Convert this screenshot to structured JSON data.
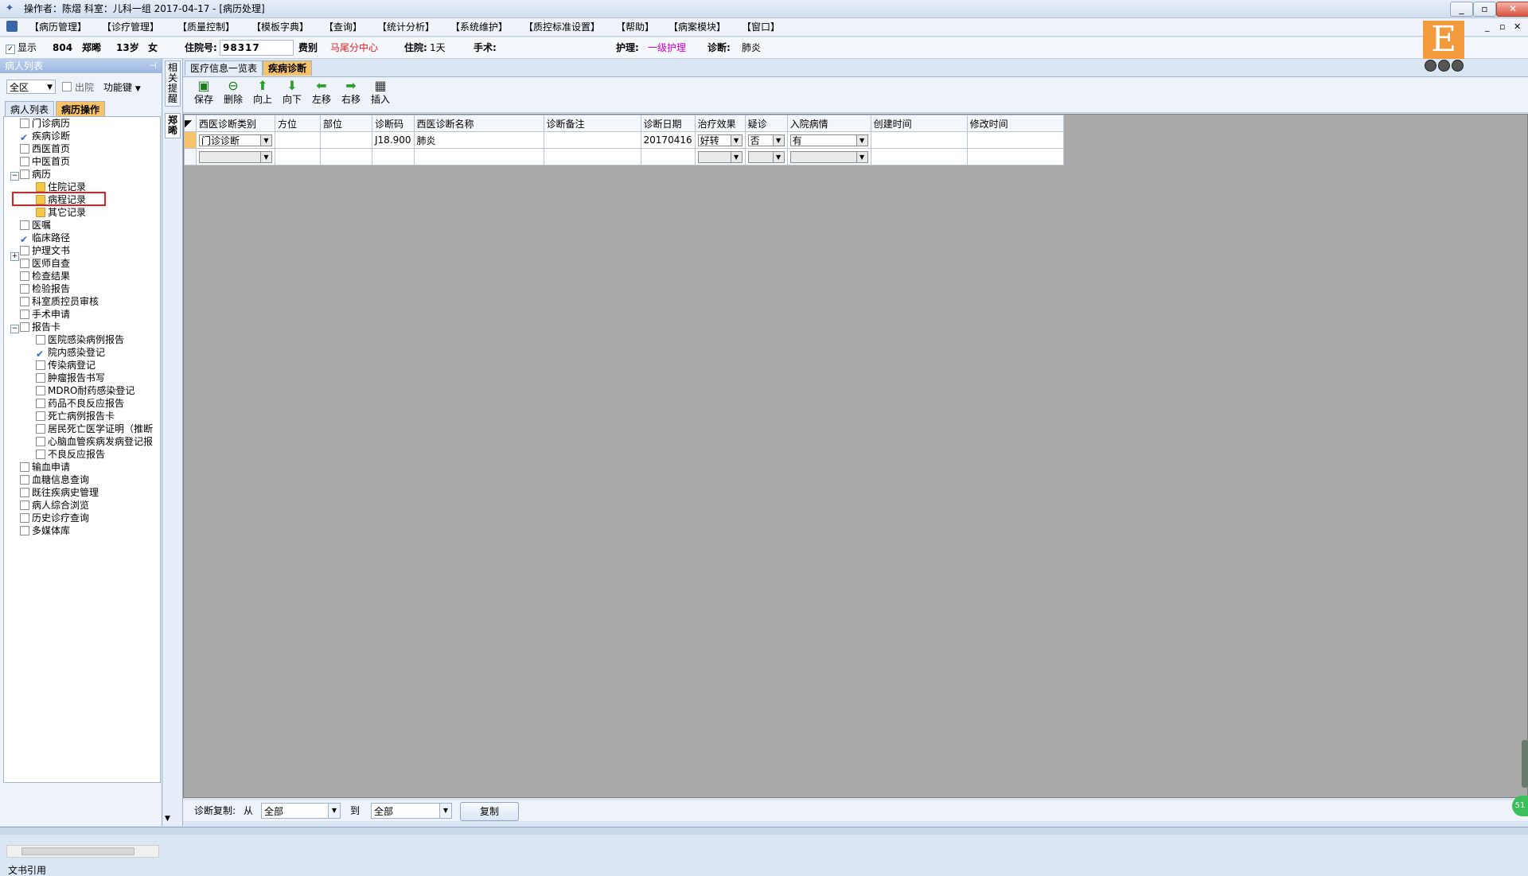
{
  "window": {
    "title": "操作者：陈熠  科室：儿科一组  2017-04-17 - [病历处理]",
    "controls": [
      "_",
      "▫",
      "✕"
    ]
  },
  "menu": {
    "items": [
      "【病历管理】",
      "【诊疗管理】",
      "【质量控制】",
      "【模板字典】",
      "【查询】",
      "【统计分析】",
      "【系统维护】",
      "【质控标准设置】",
      "【帮助】",
      "【病案模块】",
      "【窗口】"
    ],
    "mdi_controls": [
      "_",
      "▫",
      "✕"
    ]
  },
  "patient": {
    "show_label": "显示",
    "bed": "804",
    "name": "郑晞",
    "age": "13岁",
    "sex": "女",
    "admission_no_label": "住院号:",
    "admission_no": "98317",
    "fee_type_label": "费别",
    "fee_type": "马尾分中心",
    "stay_label": "住院:",
    "stay": "1天",
    "surgery_label": "手术:",
    "surgery": "",
    "nursing_label": "护理:",
    "nursing": "一级护理",
    "diagnosis_label": "诊断:",
    "diagnosis": "肺炎"
  },
  "logo": {
    "letter": "E"
  },
  "left_panel": {
    "header": "病人列表",
    "pin": "⊣",
    "area_select": "全区",
    "discharge_label": "出院",
    "function_key": "功能键",
    "tabs": [
      "病人列表",
      "病历操作"
    ],
    "doc_ref": "文书引用",
    "tree": [
      "门诊病历",
      "疾病诊断",
      "西医首页",
      "中医首页",
      "病历",
      "住院记录",
      "病程记录",
      "其它记录",
      "医嘱",
      "临床路径",
      "护理文书",
      "医师自查",
      "检查结果",
      "检验报告",
      "科室质控员审核",
      "手术申请",
      "报告卡",
      "医院感染病例报告",
      "院内感染登记",
      "传染病登记",
      "肿瘤报告书写",
      "MDRO耐药感染登记",
      "药品不良反应报告",
      "死亡病例报告卡",
      "居民死亡医学证明（推断",
      "心脑血管疾病发病登记报",
      "不良反应报告",
      "输血申请",
      "血糖信息查询",
      "既往疾病史管理",
      "病人综合浏览",
      "历史诊疗查询",
      "多媒体库"
    ]
  },
  "side_tabs": [
    "相关提醒",
    "郑晞"
  ],
  "content_tabs": [
    "医疗信息一览表",
    "疾病诊断"
  ],
  "toolbar": {
    "buttons": [
      {
        "label": "保存",
        "icon": "save-icon",
        "color": "#1a7a1a"
      },
      {
        "label": "删除",
        "icon": "minus-icon",
        "color": "#1a7a1a"
      },
      {
        "label": "向上",
        "icon": "arrow-up-icon",
        "color": "#2e9e2e"
      },
      {
        "label": "向下",
        "icon": "arrow-down-icon",
        "color": "#2e9e2e"
      },
      {
        "label": "左移",
        "icon": "arrow-left-icon",
        "color": "#2e9e2e"
      },
      {
        "label": "右移",
        "icon": "arrow-right-icon",
        "color": "#2e9e2e"
      },
      {
        "label": "插入",
        "icon": "insert-icon",
        "color": "#333333"
      }
    ]
  },
  "grid": {
    "columns": [
      "西医诊断类别",
      "方位",
      "部位",
      "诊断码",
      "西医诊断名称",
      "诊断备注",
      "诊断日期",
      "治疗效果",
      "疑诊",
      "入院病情",
      "创建时间",
      "修改时间"
    ],
    "rows": [
      {
        "category": "门诊诊断",
        "side": "",
        "site": "",
        "code": "J18.900",
        "name": "肺炎",
        "note": "",
        "date": "20170416",
        "effect": "好转",
        "suspected": "否",
        "admission": "有",
        "created": "",
        "modified": ""
      },
      {
        "category": "",
        "side": "",
        "site": "",
        "code": "",
        "name": "",
        "note": "",
        "date": "",
        "effect": "",
        "suspected": "",
        "admission": "",
        "created": "",
        "modified": ""
      }
    ]
  },
  "bottom": {
    "copy_label": "诊断复制:",
    "from_label": "从",
    "from_value": "全部",
    "to_label": "到",
    "to_value": "全部",
    "copy_button": "复制"
  },
  "tray_badge": "51"
}
